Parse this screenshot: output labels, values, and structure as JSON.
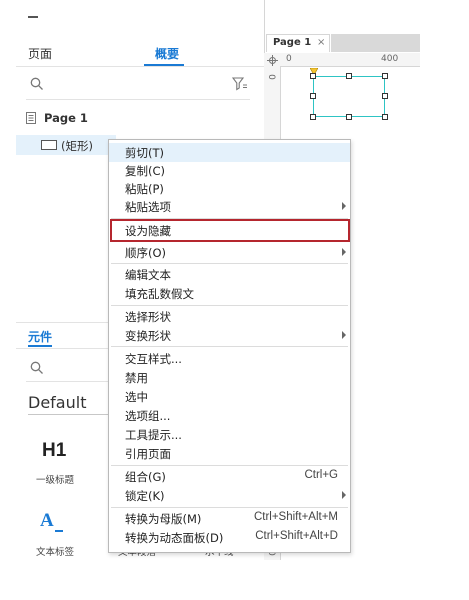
{
  "panel": {
    "tabs": [
      {
        "label": "页面"
      },
      {
        "label": "概要"
      }
    ],
    "outline": {
      "page_label": "Page 1",
      "shape_label": "(矩形)"
    },
    "library": {
      "section_title": "元件",
      "selected_library": "Default",
      "widgets": [
        {
          "icon": "H1",
          "label": "一级标题"
        },
        {
          "icon": "A_",
          "label": "文本标签"
        },
        {
          "label": "文本段落"
        },
        {
          "label": "水平线"
        }
      ]
    }
  },
  "canvas": {
    "page_tab": "Page 1",
    "close_glyph": "×",
    "ruler_h_labels": [
      "0",
      "400"
    ],
    "ruler_v_labels": [
      "0",
      "0"
    ]
  },
  "context_menu": {
    "items": [
      {
        "label": "剪切(T)"
      },
      {
        "label": "复制(C)"
      },
      {
        "label": "粘贴(P)"
      },
      {
        "label": "粘贴选项",
        "submenu": true
      },
      {
        "label": "设为隐藏"
      },
      {
        "label": "顺序(O)",
        "submenu": true
      },
      {
        "label": "编辑文本"
      },
      {
        "label": "填充乱数假文"
      },
      {
        "label": "选择形状"
      },
      {
        "label": "变换形状",
        "submenu": true
      },
      {
        "label": "交互样式..."
      },
      {
        "label": "禁用"
      },
      {
        "label": "选中"
      },
      {
        "label": "选项组..."
      },
      {
        "label": "工具提示..."
      },
      {
        "label": "引用页面"
      },
      {
        "label": "组合(G)",
        "shortcut": "Ctrl+G"
      },
      {
        "label": "锁定(K)",
        "submenu": true
      },
      {
        "label": "转换为母版(M)",
        "shortcut": "Ctrl+Shift+Alt+M"
      },
      {
        "label": "转换为动态面板(D)",
        "shortcut": "Ctrl+Shift+Alt+D"
      }
    ]
  },
  "colors": {
    "accent": "#1a7ad4",
    "selection_border": "#2ec4c4",
    "highlight_box": "#b5262e",
    "hover_row": "#e4f1fb"
  }
}
